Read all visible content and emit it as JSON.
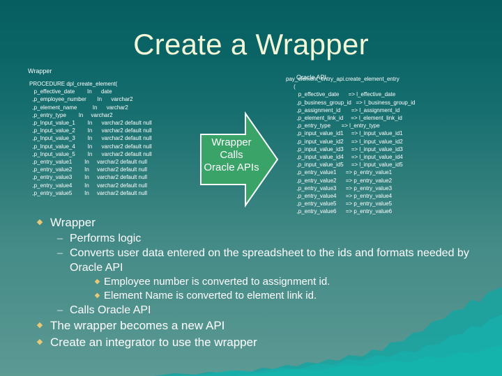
{
  "slide": {
    "title": "Create a Wrapper",
    "bg_top_color": "#075e60",
    "bg_bottom_color": "#5c9a94",
    "title_color": "#f2f7d8",
    "bullet_marker_color": "#e8c877",
    "arrow_fill_color": "#3aa367",
    "arrow_border_color": "#ffffff"
  },
  "wrapper_panel": {
    "caption": "Wrapper",
    "code": "PROCEDURE dpl_create_element(\n   p_effective_date        In      date\n  ,p_employee_number       In      varchar2\n  ,p_element_name          In      varchar2\n  ,p_entry_type        In     varchar2\n  ,p_Input_value_1        In      varchar2 default null\n  ,p_Input_value_2        In      varchar2 default null\n  ,p_Input_value_3        In      varchar2 default null\n  ,p_Input_value_4        In      varchar2 default null\n  ,p_Input_value_5        In      varchar2 default null\n  ,p_entry_value1        In     varchar2 default null\n  ,p_entry_value2        In     varchar2 default null\n  ,p_entry_value3        In     varchar2 default null\n  ,p_entry_value4        In     varchar2 default null\n  ,p_entry_value5        In     varchar2 default null"
  },
  "oracle_panel": {
    "caption": "Oracle API",
    "code": "pay_element_entry_api.create_element_entry\n     (\n        p_effective_date      => l_effective_date\n       ,p_business_group_id   => l_business_group_id\n       ,p_assignment_id       => l_assignment_id\n       ,p_element_link_id     => l_element_link_id\n       ,p_entry_type       => l_entry_type\n       ,p_input_value_id1     => l_input_value_id1\n       ,p_input_value_id2     => l_input_value_id2\n       ,p_input_value_id3     => l_input_value_id3\n       ,p_input_value_id4     => l_input_value_id4\n       ,p_input_value_id5     => l_input_value_id5\n       ,p_entry_value1      => p_entry_value1\n       ,p_entry_value2      => p_entry_value2\n       ,p_entry_value3      => p_entry_value3\n       ,p_entry_value4      => p_entry_value4\n       ,p_entry_value5      => p_entry_value5\n       ,p_entry_value6      => p_entry_value6"
  },
  "arrow": {
    "line1": "Wrapper",
    "line2": "Calls",
    "line3": "Oracle APIs"
  },
  "bullets": [
    {
      "level": 1,
      "marker": "◆",
      "text": "Wrapper"
    },
    {
      "level": 2,
      "marker": "–",
      "text": "Performs logic"
    },
    {
      "level": 2,
      "marker": "–",
      "text": "Converts user data entered on the spreadsheet to the ids and formats needed by Oracle API"
    },
    {
      "level": 3,
      "marker": "◆",
      "text": "Employee number is converted to assignment id."
    },
    {
      "level": 3,
      "marker": "◆",
      "text": "Element Name is converted to element link id."
    },
    {
      "level": 2,
      "marker": "–",
      "text": "Calls Oracle API"
    },
    {
      "level": 1,
      "marker": "◆",
      "text": "The wrapper becomes a new API"
    },
    {
      "level": 1,
      "marker": "◆",
      "text": "Create an integrator to use the wrapper"
    }
  ]
}
